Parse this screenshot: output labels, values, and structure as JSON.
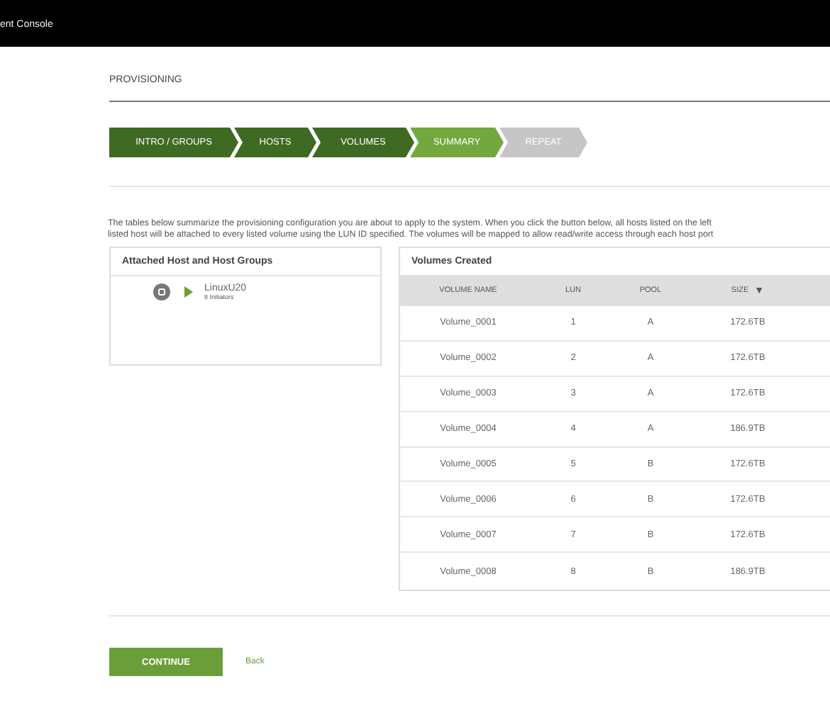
{
  "header": {
    "title": "ent Console"
  },
  "page_title": "PROVISIONING",
  "steps": [
    {
      "label": "INTRO / GROUPS",
      "kind": "done"
    },
    {
      "label": "HOSTS",
      "kind": "done"
    },
    {
      "label": "VOLUMES",
      "kind": "done"
    },
    {
      "label": "SUMMARY",
      "kind": "current"
    },
    {
      "label": "REPEAT",
      "kind": "todo"
    }
  ],
  "description": [
    "The tables below summarize the provisioning configuration you are about to apply to the system. When you click the button below, all hosts listed on the left",
    "listed host will be attached to every listed volume using the LUN ID specified. The volumes will be mapped to allow read/write access through each host port"
  ],
  "hosts_panel": {
    "title": "Attached Host and Host Groups",
    "hosts": [
      {
        "name": "LinuxU20",
        "detail": "8 Initiators",
        "expanded": false
      }
    ]
  },
  "volumes_panel": {
    "title": "Volumes Created",
    "columns": [
      "VOLUME NAME",
      "LUN",
      "POOL",
      "SIZE"
    ],
    "sort_icon": "▼",
    "rows": [
      [
        "Volume_0001",
        "1",
        "A",
        "172.6TB"
      ],
      [
        "Volume_0002",
        "2",
        "A",
        "172.6TB"
      ],
      [
        "Volume_0003",
        "3",
        "A",
        "172.6TB"
      ],
      [
        "Volume_0004",
        "4",
        "A",
        "186.9TB"
      ],
      [
        "Volume_0005",
        "5",
        "B",
        "172.6TB"
      ],
      [
        "Volume_0006",
        "6",
        "B",
        "172.6TB"
      ],
      [
        "Volume_0007",
        "7",
        "B",
        "172.6TB"
      ],
      [
        "Volume_0008",
        "8",
        "B",
        "186.9TB"
      ]
    ]
  },
  "buttons": {
    "continue": "CONTINUE",
    "back": "Back"
  }
}
